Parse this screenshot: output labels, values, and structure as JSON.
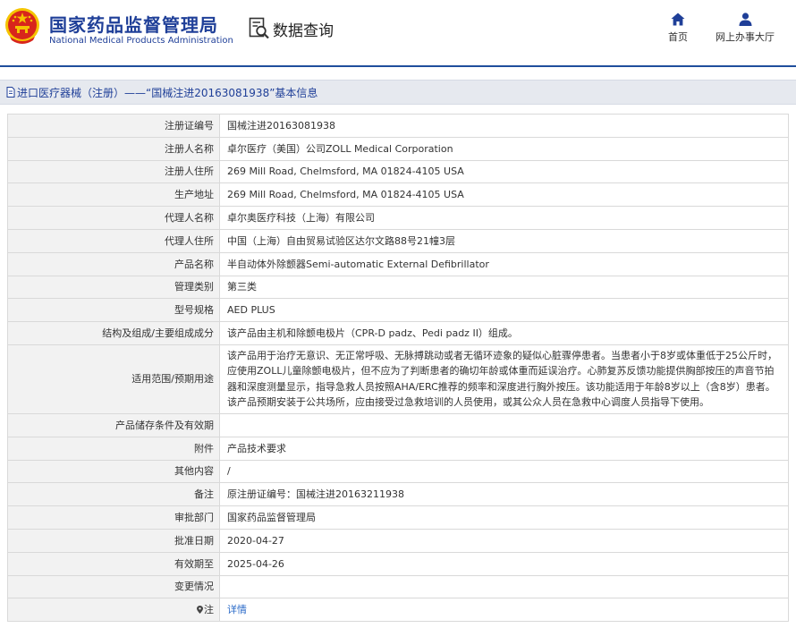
{
  "header": {
    "org_name_cn": "国家药品监督管理局",
    "org_name_en": "National Medical Products Administration",
    "query_label": "数据查询",
    "nav": [
      {
        "label": "首页",
        "icon": "home-icon"
      },
      {
        "label": "网上办事大厅",
        "icon": "user-icon"
      }
    ],
    "colors": {
      "brand": "#1f3f98",
      "emblem_red": "#d8261c",
      "emblem_gold": "#f5c400"
    }
  },
  "breadcrumb": {
    "text": "进口医疗器械（注册）——“国械注进20163081938”基本信息"
  },
  "rows": [
    {
      "key": "注册证编号",
      "value": "国械注进20163081938"
    },
    {
      "key": "注册人名称",
      "value": "卓尔医疗（美国）公司ZOLL Medical Corporation"
    },
    {
      "key": "注册人住所",
      "value": "269 Mill Road, Chelmsford, MA 01824-4105 USA"
    },
    {
      "key": "生产地址",
      "value": "269 Mill Road, Chelmsford, MA 01824-4105 USA"
    },
    {
      "key": "代理人名称",
      "value": "卓尔奥医疗科技（上海）有限公司"
    },
    {
      "key": "代理人住所",
      "value": "中国（上海）自由贸易试验区达尔文路88号21幢3层"
    },
    {
      "key": "产品名称",
      "value": "半自动体外除颤器Semi-automatic External Defibrillator"
    },
    {
      "key": "管理类别",
      "value": "第三类"
    },
    {
      "key": "型号规格",
      "value": "AED PLUS"
    },
    {
      "key": "结构及组成/主要组成成分",
      "value": "该产品由主机和除颤电极片（CPR-D padz、Pedi padz II）组成。"
    },
    {
      "key": "适用范围/预期用途",
      "value": "该产品用于治疗无意识、无正常呼吸、无脉搏跳动或者无循环迹象的疑似心脏骤停患者。当患者小于8岁或体重低于25公斤时，应使用ZOLL儿童除颤电极片，但不应为了判断患者的确切年龄或体重而延误治疗。心肺复苏反馈功能提供胸部按压的声音节拍器和深度测量显示，指导急救人员按照AHA/ERC推荐的频率和深度进行胸外按压。该功能适用于年龄8岁以上（含8岁）患者。该产品预期安装于公共场所，应由接受过急救培训的人员使用，或其公众人员在急救中心调度人员指导下使用。"
    },
    {
      "key": "产品储存条件及有效期",
      "value": ""
    },
    {
      "key": "附件",
      "value": "产品技术要求"
    },
    {
      "key": "其他内容",
      "value": "/"
    },
    {
      "key": "备注",
      "value": "原注册证编号：国械注进20163211938"
    },
    {
      "key": "审批部门",
      "value": "国家药品监督管理局"
    },
    {
      "key": "批准日期",
      "value": "2020-04-27"
    },
    {
      "key": "有效期至",
      "value": "2025-04-26"
    },
    {
      "key": "变更情况",
      "value": ""
    },
    {
      "key": "注",
      "value": "详情",
      "key_icon": "pin-icon"
    }
  ]
}
